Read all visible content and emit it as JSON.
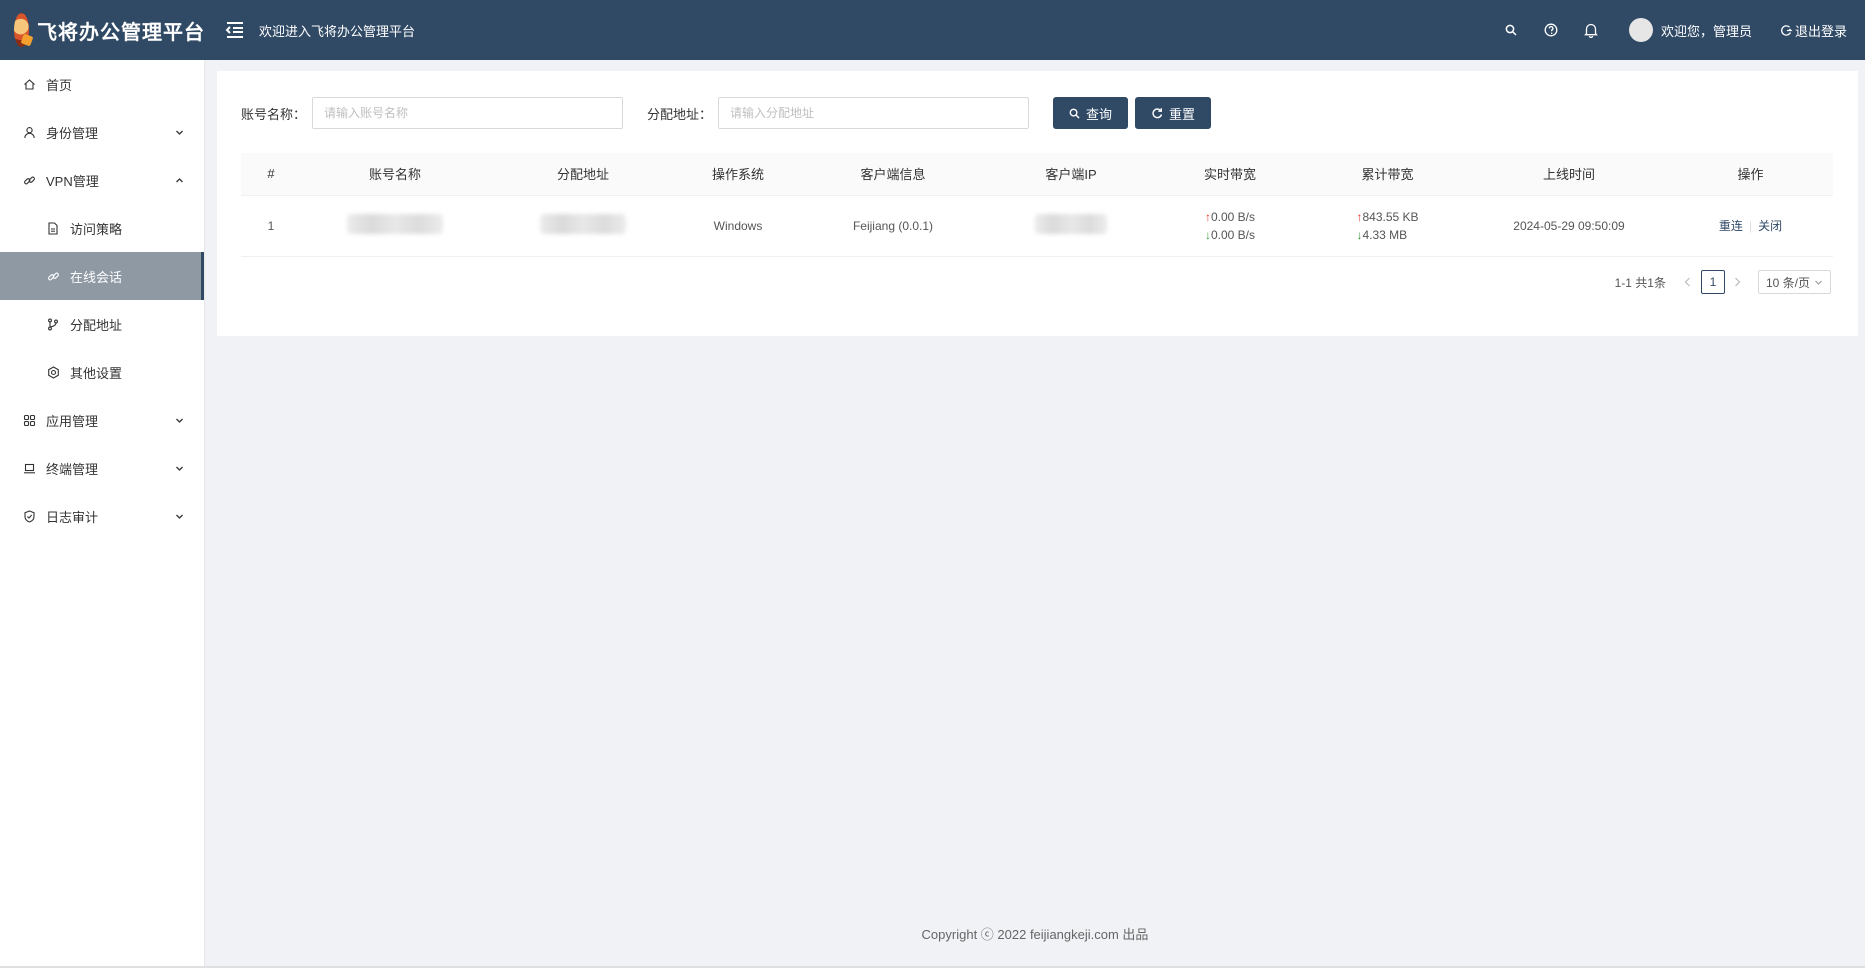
{
  "header": {
    "brand": "飞将办公管理平台",
    "welcome": "欢迎进入飞将办公管理平台",
    "user_greeting": "欢迎您，管理员",
    "logout_label": "退出登录",
    "bg_color": "#304a66"
  },
  "sidebar": {
    "items": [
      {
        "label": "首页",
        "icon": "home-icon"
      },
      {
        "label": "身份管理",
        "icon": "user-icon",
        "expanded": false
      },
      {
        "label": "VPN管理",
        "icon": "link-icon",
        "expanded": true
      },
      {
        "label": "访问策略",
        "icon": "file-icon"
      },
      {
        "label": "在线会话",
        "icon": "link-icon",
        "active": true
      },
      {
        "label": "分配地址",
        "icon": "branch-icon"
      },
      {
        "label": "其他设置",
        "icon": "gear-icon"
      },
      {
        "label": "应用管理",
        "icon": "apps-icon",
        "expanded": false
      },
      {
        "label": "终端管理",
        "icon": "laptop-icon",
        "expanded": false
      },
      {
        "label": "日志审计",
        "icon": "shield-icon",
        "expanded": false
      }
    ]
  },
  "search": {
    "account_label": "账号名称：",
    "account_placeholder": "请输入账号名称",
    "account_value": "",
    "address_label": "分配地址：",
    "address_placeholder": "请输入分配地址",
    "address_value": "",
    "query_label": "查询",
    "reset_label": "重置"
  },
  "table": {
    "columns": [
      "#",
      "账号名称",
      "分配地址",
      "操作系统",
      "客户端信息",
      "客户端IP",
      "实时带宽",
      "累计带宽",
      "上线时间",
      "操作"
    ],
    "rows": [
      {
        "index": "1",
        "account": "",
        "address": "",
        "os": "Windows",
        "client": "Feijiang (0.0.1)",
        "client_ip": "",
        "rt_up": "0.00 B/s",
        "rt_down": "0.00 B/s",
        "total_up": "843.55 KB",
        "total_down": "4.33 MB",
        "online_time": "2024-05-29 09:50:09",
        "op_reconnect": "重连",
        "op_close": "关闭"
      }
    ]
  },
  "pagination": {
    "total_text": "1-1 共1条",
    "current_page": "1",
    "page_size": "10 条/页"
  },
  "footer": {
    "copyright": "Copyright ⓒ 2022 feijiangkeji.com 出品"
  }
}
